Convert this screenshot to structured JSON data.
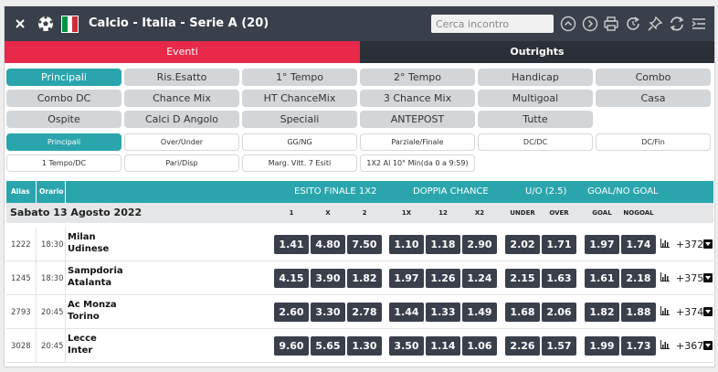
{
  "header": {
    "title": "Calcio - Italia - Serie A (20)",
    "search_placeholder": "Cerca incontro",
    "flag_colors": [
      "#009246",
      "#ffffff",
      "#ce2b37"
    ]
  },
  "tabs": [
    {
      "label": "Eventi",
      "active": true
    },
    {
      "label": "Outrights",
      "active": false
    }
  ],
  "market_buttons": [
    {
      "label": "Principali",
      "selected": true
    },
    {
      "label": "Ris.Esatto"
    },
    {
      "label": "1° Tempo"
    },
    {
      "label": "2° Tempo"
    },
    {
      "label": "Handicap"
    },
    {
      "label": "Combo"
    },
    {
      "label": "Combo DC"
    },
    {
      "label": "Chance Mix"
    },
    {
      "label": "HT ChanceMix"
    },
    {
      "label": "3 Chance Mix"
    },
    {
      "label": "Multigoal"
    },
    {
      "label": "Casa"
    },
    {
      "label": "Ospite"
    },
    {
      "label": "Calci D Angolo"
    },
    {
      "label": "Speciali"
    },
    {
      "label": "ANTEPOST"
    },
    {
      "label": "Tutte"
    }
  ],
  "sub_buttons": [
    {
      "label": "Principali",
      "selected": true
    },
    {
      "label": "Over/Under"
    },
    {
      "label": "GG/NG"
    },
    {
      "label": "Parziale/Finale"
    },
    {
      "label": "DC/DC"
    },
    {
      "label": "DC/Fin"
    },
    {
      "label": "1 Tempo/DC"
    },
    {
      "label": "Pari/Disp"
    },
    {
      "label": "Marg. Vitt. 7 Esiti"
    },
    {
      "label": "1X2 Al 10° Min(da 0 a 9:59)"
    }
  ],
  "table": {
    "col_alias": "Alias",
    "col_orario": "Orario",
    "groups": [
      "ESITO FINALE 1X2",
      "DOPPIA CHANCE",
      "U/O (2.5)",
      "GOAL/NO GOAL"
    ],
    "date": "Sabato 13 Agosto 2022",
    "subheaders": [
      "1",
      "X",
      "2",
      "1X",
      "12",
      "X2",
      "UNDER",
      "OVER",
      "GOAL",
      "NOGOAL"
    ],
    "rows": [
      {
        "alias": "1222",
        "time": "18:30",
        "home": "Milan",
        "away": "Udinese",
        "odds": [
          "1.41",
          "4.80",
          "7.50",
          "1.10",
          "1.18",
          "2.90",
          "2.02",
          "1.71",
          "1.97",
          "1.74"
        ],
        "more": "+372"
      },
      {
        "alias": "1245",
        "time": "18:30",
        "home": "Sampdoria",
        "away": "Atalanta",
        "odds": [
          "4.15",
          "3.90",
          "1.82",
          "1.97",
          "1.26",
          "1.24",
          "2.15",
          "1.63",
          "1.61",
          "2.18"
        ],
        "more": "+375"
      },
      {
        "alias": "2793",
        "time": "20:45",
        "home": "Ac Monza",
        "away": "Torino",
        "odds": [
          "2.60",
          "3.30",
          "2.78",
          "1.44",
          "1.33",
          "1.49",
          "1.68",
          "2.06",
          "1.82",
          "1.88"
        ],
        "more": "+374"
      },
      {
        "alias": "3028",
        "time": "20:45",
        "home": "Lecce",
        "away": "Inter",
        "odds": [
          "9.60",
          "5.65",
          "1.30",
          "3.50",
          "1.14",
          "1.06",
          "2.26",
          "1.57",
          "1.99",
          "1.73"
        ],
        "more": "+367"
      }
    ]
  }
}
